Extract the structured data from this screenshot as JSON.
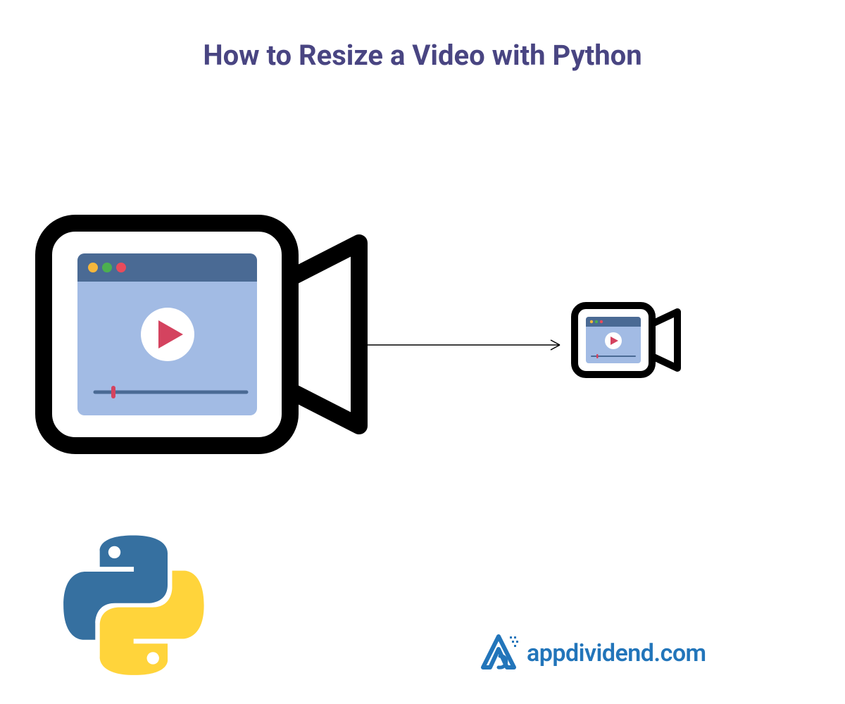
{
  "title": "How to Resize a Video with Python",
  "brand": "appdividend.com",
  "colors": {
    "title": "#494582",
    "brand": "#2275ba",
    "window_header": "#4a6a94",
    "window_body": "#a2bbe4",
    "play_triangle": "#d4435f",
    "python_blue": "#3670a0",
    "python_yellow": "#ffd43b"
  },
  "diagram": {
    "source": "large-video-camera",
    "target": "small-video-camera",
    "relation": "resize-to-smaller"
  }
}
